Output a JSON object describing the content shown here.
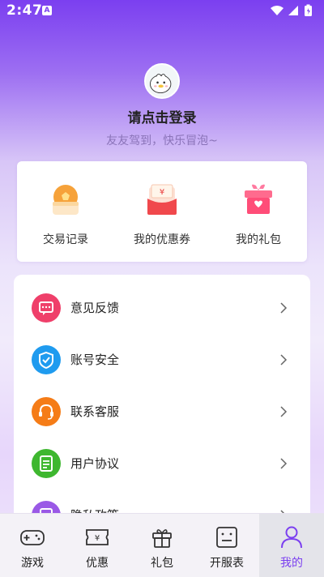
{
  "status_bar": {
    "time": "2:47",
    "notification_badge": "A"
  },
  "profile": {
    "login_prompt": "请点击登录",
    "tagline": "友友驾到，快乐冒泡~"
  },
  "quick_actions": [
    {
      "label": "交易记录",
      "icon": "wallet-icon"
    },
    {
      "label": "我的优惠券",
      "icon": "coupon-icon"
    },
    {
      "label": "我的礼包",
      "icon": "gift-box-icon"
    }
  ],
  "menu": [
    {
      "label": "意见反馈",
      "icon": "feedback-icon",
      "color": "#ef3f6a"
    },
    {
      "label": "账号安全",
      "icon": "shield-icon",
      "color": "#1f9bef"
    },
    {
      "label": "联系客服",
      "icon": "headset-icon",
      "color": "#f57c17"
    },
    {
      "label": "用户协议",
      "icon": "document-icon",
      "color": "#3eb72f"
    },
    {
      "label": "隐私政策",
      "icon": "privacy-icon",
      "color": "#9a59e6"
    }
  ],
  "bottom_nav": [
    {
      "label": "游戏",
      "icon": "gamepad-icon",
      "active": false
    },
    {
      "label": "优惠",
      "icon": "ticket-icon",
      "active": false
    },
    {
      "label": "礼包",
      "icon": "gift-icon",
      "active": false
    },
    {
      "label": "开服表",
      "icon": "server-list-icon",
      "active": false
    },
    {
      "label": "我的",
      "icon": "user-icon",
      "active": true
    }
  ],
  "colors": {
    "accent": "#7b3ff0",
    "card_bg": "#ffffff"
  }
}
